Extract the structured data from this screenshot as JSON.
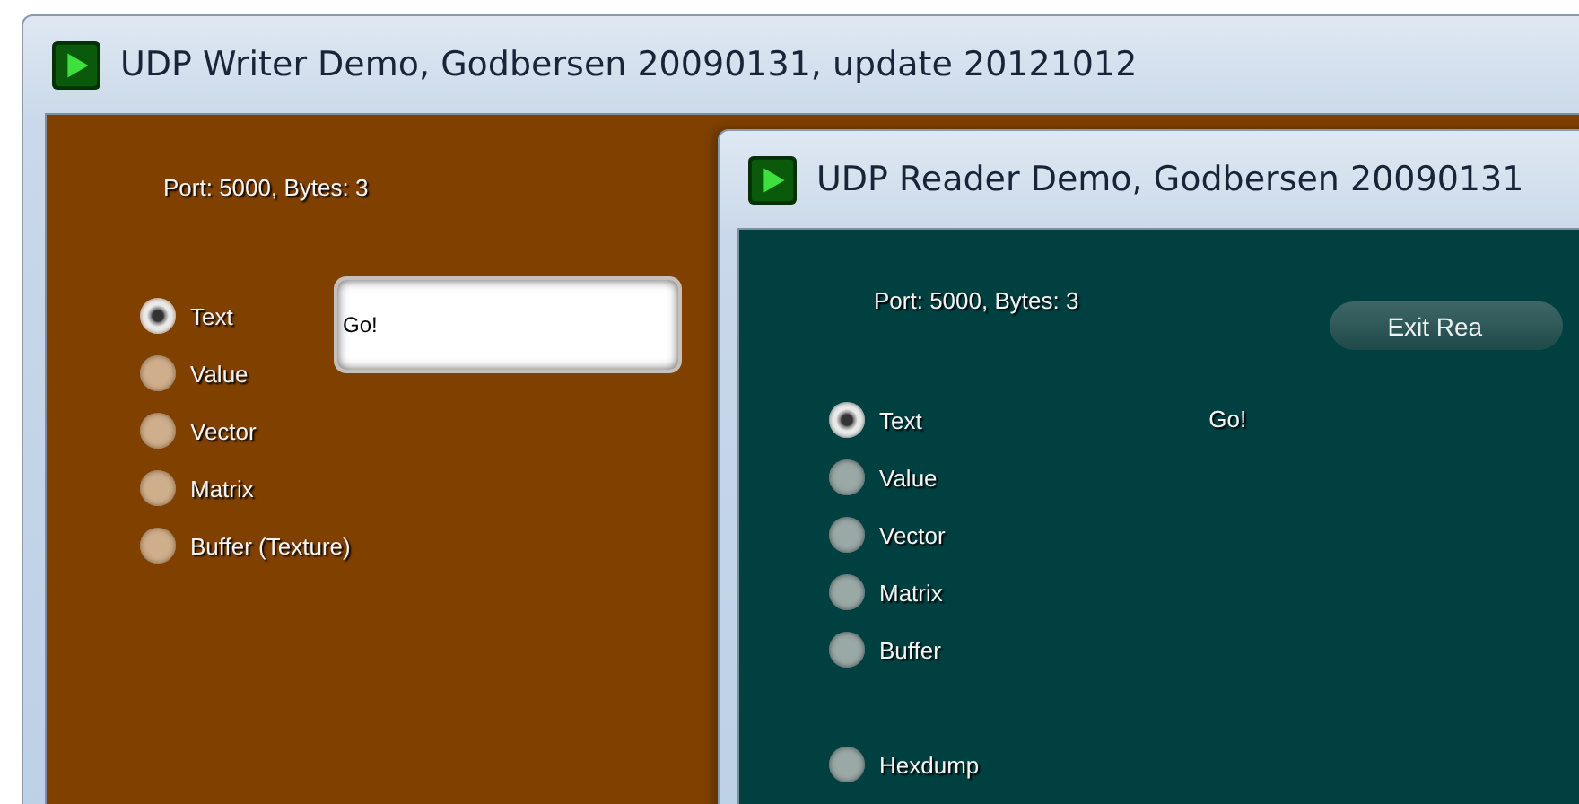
{
  "writer": {
    "title": "UDP Writer Demo, Godbersen 20090131, update 20121012",
    "status": "Port: 5000,  Bytes: 3",
    "modes": [
      {
        "label": "Text",
        "selected": true
      },
      {
        "label": "Value",
        "selected": false
      },
      {
        "label": "Vector",
        "selected": false
      },
      {
        "label": "Matrix",
        "selected": false
      },
      {
        "label": "Buffer (Texture)",
        "selected": false
      }
    ],
    "input": {
      "value": "Go!"
    }
  },
  "reader": {
    "title": "UDP Reader Demo, Godbersen 20090131",
    "status": "Port: 5000, Bytes: 3",
    "exit_button": "Exit Rea",
    "received": "Go!",
    "modes": [
      {
        "label": "Text",
        "selected": true
      },
      {
        "label": "Value",
        "selected": false
      },
      {
        "label": "Vector",
        "selected": false
      },
      {
        "label": "Matrix",
        "selected": false
      },
      {
        "label": "Buffer",
        "selected": false
      }
    ],
    "hexdump": {
      "label": "Hexdump",
      "selected": false
    }
  }
}
